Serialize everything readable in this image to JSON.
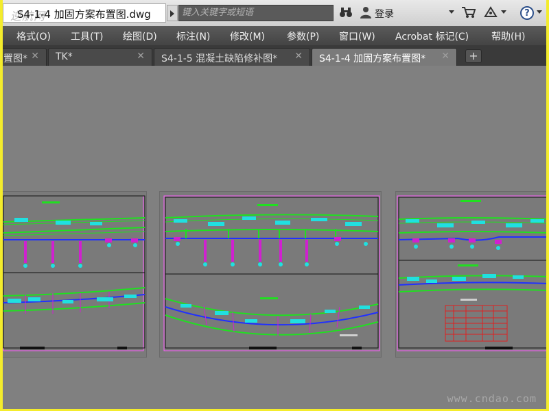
{
  "titlebar": {
    "logo": "逆航网",
    "document_title": "S4-1-4 加固方案布置图.dwg",
    "search_placeholder": "键入关键字或短语",
    "login_label": "登录"
  },
  "icons": {
    "binoculars": "binoculars-icon",
    "user": "user-icon",
    "cart": "cart-icon",
    "network": "network-icon",
    "help": "help-icon"
  },
  "menu": [
    "格式(O)",
    "工具(T)",
    "绘图(D)",
    "标注(N)",
    "修改(M)",
    "参数(P)",
    "窗口(W)",
    "Acrobat 标记(C)",
    "帮助(H)"
  ],
  "tabs": [
    {
      "label": "置图*",
      "active": false
    },
    {
      "label": "TK*",
      "active": false
    },
    {
      "label": "S4-1-5 混凝土缺陷修补图*",
      "active": false
    },
    {
      "label": "S4-1-4 加固方案布置图*",
      "active": true
    }
  ],
  "newtab_label": "+",
  "watermark": "www.cndao.com",
  "colors": {
    "canvas": "#808080",
    "menubar": "#4e4e4e",
    "drawing_green": "#20e020",
    "drawing_blue": "#2030ff",
    "drawing_magenta": "#d020d0",
    "drawing_cyan": "#20e0e0",
    "drawing_red": "#e02020",
    "frame_border": "#ff5cff"
  }
}
